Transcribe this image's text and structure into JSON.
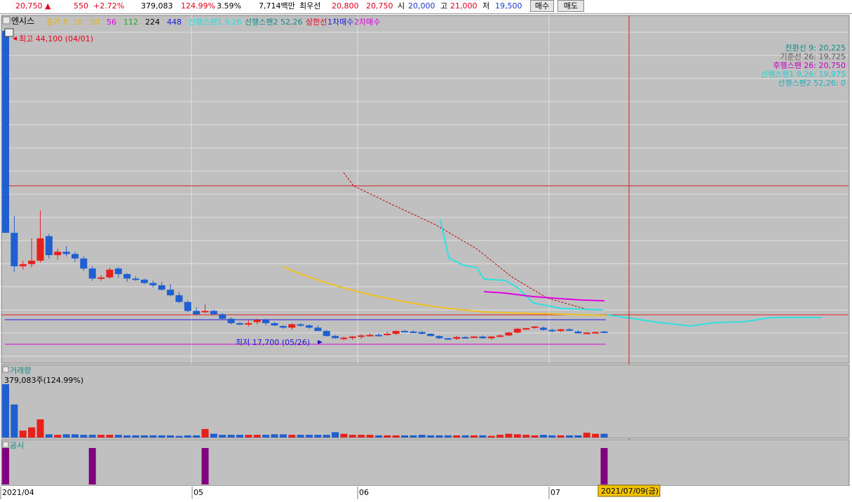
{
  "topbar": {
    "price": "20,750",
    "price_arrow": "▲",
    "change": "550",
    "change_pct": "+2.72%",
    "volume": "379,083",
    "volume_ratio": "124.99%",
    "turnover": "3.59%",
    "amount": "7,714백만",
    "best_ask_label": "최우선",
    "best_ask": "20,800",
    "best_bid": "20,750",
    "open_label": "시",
    "open": "20,000",
    "high_label": "고",
    "high": "21,000",
    "low_label": "저",
    "low": "19,500",
    "buy_label": "매수",
    "sell_label": "매도"
  },
  "legend": {
    "stock_name": "엔시스",
    "items": [
      {
        "label": "종가 5",
        "color": "#e8b400"
      },
      {
        "label": "10",
        "color": "#e8b400"
      },
      {
        "label": "20",
        "color": "#e8b400"
      },
      {
        "label": "56",
        "color": "#e000e0"
      },
      {
        "label": "112",
        "color": "#22aa22"
      },
      {
        "label": "224",
        "color": "#000000"
      },
      {
        "label": "448",
        "color": "#1a1ad6"
      },
      {
        "label": "선행스팬1 9,26",
        "color": "#20e0e0"
      },
      {
        "label": "선행스팬2 52,26",
        "color": "#108a8a"
      },
      {
        "label": "상한선",
        "color": "#e8001c"
      },
      {
        "label": "1차매수",
        "color": "#1a1ad6"
      },
      {
        "label": "2차매수",
        "color": "#e000e0"
      }
    ]
  },
  "ichimoku_readout": [
    {
      "label": "전환선 9: 20,225",
      "color": "#108a8a"
    },
    {
      "label": "기준선 26: 19,725",
      "color": "#606060"
    },
    {
      "label": "후행스팬 26: 20,750",
      "color": "#c000c0"
    },
    {
      "label": "선행스팬1 9,26: 19,975",
      "color": "#20d0d0"
    },
    {
      "label": "선행스팬2 52,26: 0",
      "color": "#20b0c0"
    }
  ],
  "annotations": {
    "high": "최고 44,100 (04/01)",
    "low": "최저 17,700 (05/26)"
  },
  "volume_panel": {
    "title": "거래량",
    "value": "379,083주(124.99%)"
  },
  "disclosure_panel": {
    "title": "공시"
  },
  "xaxis": {
    "labels": [
      "2021/04",
      "05",
      "06",
      "07"
    ],
    "cursor_label": "2021/07/09(금)"
  },
  "colors": {
    "up": "#e8201c",
    "down": "#1f5fcf",
    "panel_bg": "#c0c0c0",
    "ma": "#f0c020",
    "span1": "#30e0e0",
    "lagging": "#e000e0",
    "trend": "#c00000"
  },
  "chart_data": {
    "type": "candlestick",
    "categories": [
      "04/01",
      "04/02",
      "04/05",
      "04/06",
      "04/07",
      "04/08",
      "04/09",
      "04/12",
      "04/13",
      "04/14",
      "04/15",
      "04/16",
      "04/19",
      "04/20",
      "04/21",
      "04/22",
      "04/23",
      "04/26",
      "04/27",
      "04/28",
      "04/29",
      "04/30",
      "05/03",
      "05/04",
      "05/06",
      "05/07",
      "05/10",
      "05/11",
      "05/12",
      "05/13",
      "05/14",
      "05/17",
      "05/18",
      "05/20",
      "05/21",
      "05/24",
      "05/25",
      "05/26",
      "05/27",
      "05/28",
      "05/31",
      "06/01",
      "06/02",
      "06/03",
      "06/04",
      "06/07",
      "06/08",
      "06/09",
      "06/10",
      "06/11",
      "06/14",
      "06/15",
      "06/16",
      "06/17",
      "06/18",
      "06/21",
      "06/22",
      "06/23",
      "06/24",
      "06/25",
      "06/28",
      "06/29",
      "06/30",
      "07/01",
      "07/02",
      "07/05",
      "07/06",
      "07/07",
      "07/08",
      "07/09"
    ],
    "ohlc": [
      [
        44100,
        44100,
        26000,
        26000
      ],
      [
        26000,
        27500,
        22500,
        23000
      ],
      [
        23000,
        23500,
        22700,
        23200
      ],
      [
        23200,
        25500,
        22900,
        23500
      ],
      [
        23500,
        28000,
        23300,
        25500
      ],
      [
        25700,
        25900,
        23700,
        24000
      ],
      [
        24000,
        24600,
        23600,
        24300
      ],
      [
        24300,
        24800,
        23900,
        24100
      ],
      [
        24100,
        24300,
        23400,
        23700
      ],
      [
        23700,
        23900,
        22600,
        22800
      ],
      [
        22800,
        23000,
        21700,
        21900
      ],
      [
        21900,
        22200,
        21700,
        22000
      ],
      [
        22000,
        22900,
        21900,
        22700
      ],
      [
        22800,
        22950,
        21950,
        22300
      ],
      [
        22300,
        22400,
        21600,
        21900
      ],
      [
        21900,
        22100,
        21700,
        21800
      ],
      [
        21800,
        21900,
        21400,
        21500
      ],
      [
        21500,
        21700,
        21100,
        21300
      ],
      [
        21300,
        21600,
        20800,
        20900
      ],
      [
        20900,
        21400,
        20300,
        20400
      ],
      [
        20400,
        20700,
        19700,
        19800
      ],
      [
        19800,
        19900,
        18900,
        19000
      ],
      [
        19000,
        19300,
        18600,
        18700
      ],
      [
        18900,
        19600,
        18800,
        19000
      ],
      [
        19000,
        19100,
        18600,
        18700
      ],
      [
        18700,
        18800,
        18200,
        18300
      ],
      [
        18300,
        18400,
        17800,
        17900
      ],
      [
        17900,
        18000,
        17700,
        17800
      ],
      [
        17800,
        18200,
        17600,
        17900
      ],
      [
        18000,
        18300,
        17800,
        18200
      ],
      [
        18200,
        18300,
        17700,
        17900
      ],
      [
        17900,
        18000,
        17650,
        17700
      ],
      [
        17650,
        17700,
        17400,
        17500
      ],
      [
        17500,
        17900,
        17300,
        17800
      ],
      [
        17800,
        17900,
        17600,
        17700
      ],
      [
        17700,
        17800,
        17400,
        17500
      ],
      [
        17500,
        17700,
        17200,
        17200
      ],
      [
        17200,
        17300,
        16700,
        16750
      ],
      [
        16750,
        16850,
        16500,
        16560
      ],
      [
        16560,
        16700,
        16350,
        16600
      ],
      [
        16600,
        16750,
        16400,
        16700
      ],
      [
        16700,
        16900,
        16500,
        16800
      ],
      [
        16800,
        17000,
        16700,
        16850
      ],
      [
        16850,
        17000,
        16750,
        16800
      ],
      [
        16900,
        17150,
        16800,
        16950
      ],
      [
        16950,
        17250,
        16850,
        17200
      ],
      [
        17200,
        17300,
        17100,
        17150
      ],
      [
        17150,
        17250,
        17000,
        17100
      ],
      [
        17100,
        17200,
        16900,
        16950
      ],
      [
        16950,
        17000,
        16700,
        16750
      ],
      [
        16750,
        16800,
        16500,
        16550
      ],
      [
        16550,
        16600,
        16400,
        16450
      ],
      [
        16500,
        16750,
        16400,
        16650
      ],
      [
        16650,
        16750,
        16500,
        16600
      ],
      [
        16650,
        16750,
        16600,
        16700
      ],
      [
        16700,
        16800,
        16500,
        16550
      ],
      [
        16550,
        16750,
        16400,
        16700
      ],
      [
        16700,
        16900,
        16650,
        16800
      ],
      [
        16800,
        17100,
        16750,
        17050
      ],
      [
        17050,
        17500,
        17000,
        17400
      ],
      [
        17400,
        17500,
        17300,
        17450
      ],
      [
        17500,
        17650,
        17400,
        17600
      ],
      [
        17500,
        17600,
        17200,
        17300
      ],
      [
        17300,
        17400,
        17100,
        17200
      ],
      [
        17200,
        17400,
        17100,
        17350
      ],
      [
        17350,
        17450,
        17200,
        17250
      ],
      [
        17150,
        17250,
        16950,
        17000
      ],
      [
        17000,
        17100,
        16900,
        17050
      ],
      [
        17050,
        17150,
        17000,
        17100
      ],
      [
        17150,
        17200,
        17000,
        17080
      ]
    ],
    "volume_relative": [
      1.0,
      0.62,
      0.13,
      0.19,
      0.34,
      0.06,
      0.05,
      0.06,
      0.06,
      0.05,
      0.05,
      0.05,
      0.05,
      0.05,
      0.04,
      0.04,
      0.04,
      0.04,
      0.04,
      0.04,
      0.03,
      0.04,
      0.04,
      0.16,
      0.07,
      0.05,
      0.05,
      0.05,
      0.05,
      0.05,
      0.05,
      0.06,
      0.06,
      0.05,
      0.05,
      0.05,
      0.05,
      0.05,
      0.1,
      0.07,
      0.05,
      0.05,
      0.05,
      0.04,
      0.04,
      0.04,
      0.04,
      0.04,
      0.05,
      0.04,
      0.04,
      0.04,
      0.04,
      0.04,
      0.04,
      0.04,
      0.03,
      0.05,
      0.07,
      0.06,
      0.05,
      0.04,
      0.05,
      0.04,
      0.04,
      0.04,
      0.04,
      0.09,
      0.07,
      0.07
    ],
    "disclosures": [
      "04/01",
      "04/15",
      "05/04",
      "07/09"
    ]
  }
}
